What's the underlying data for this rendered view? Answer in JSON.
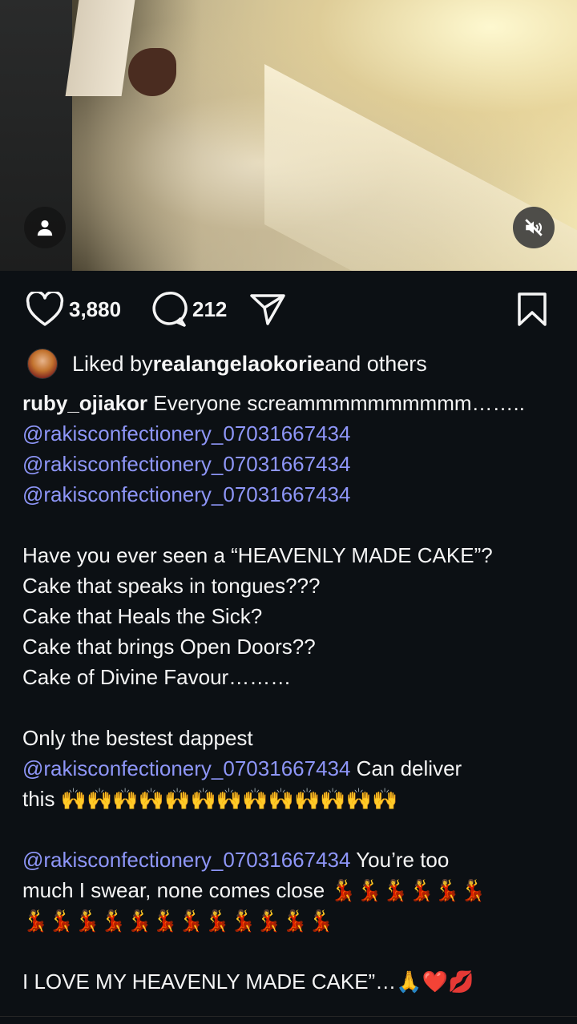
{
  "media": {
    "user_tag_icon": "person-icon",
    "mute_icon": "speaker-muted-icon"
  },
  "actions": {
    "likes": "3,880",
    "comments": "212",
    "like_icon": "heart-icon",
    "comment_icon": "comment-bubble-icon",
    "share_icon": "paper-plane-icon",
    "save_icon": "bookmark-icon"
  },
  "liked_by": {
    "prefix": "Liked by ",
    "user": "realangelaokorie",
    "suffix": " and others"
  },
  "caption": {
    "username": "ruby_ojiakor",
    "first_text": " Everyone screammmmmmmmmm……..",
    "mention": "@rakisconfectionery_07031667434",
    "q1": "Have you ever seen a “HEAVENLY MADE CAKE”?",
    "q2": "Cake that speaks in tongues???",
    "q3": "Cake that Heals the Sick?",
    "q4": "Cake that brings Open Doors??",
    "q5": "Cake of Divine Favour………",
    "p2_1": "Only the bestest dappest",
    "p2_2_tail": "  Can deliver",
    "p2_3": "this 🙌🙌🙌🙌🙌🙌🙌🙌🙌🙌🙌🙌🙌",
    "p3_1_tail": "  You’re too",
    "p3_2": "much I swear, none comes close 💃💃💃💃💃💃",
    "p3_3": "💃💃💃💃💃💃💃💃💃💃💃💃",
    "p4": "I LOVE MY HEAVENLY MADE CAKE”…🙏❤️💋"
  }
}
